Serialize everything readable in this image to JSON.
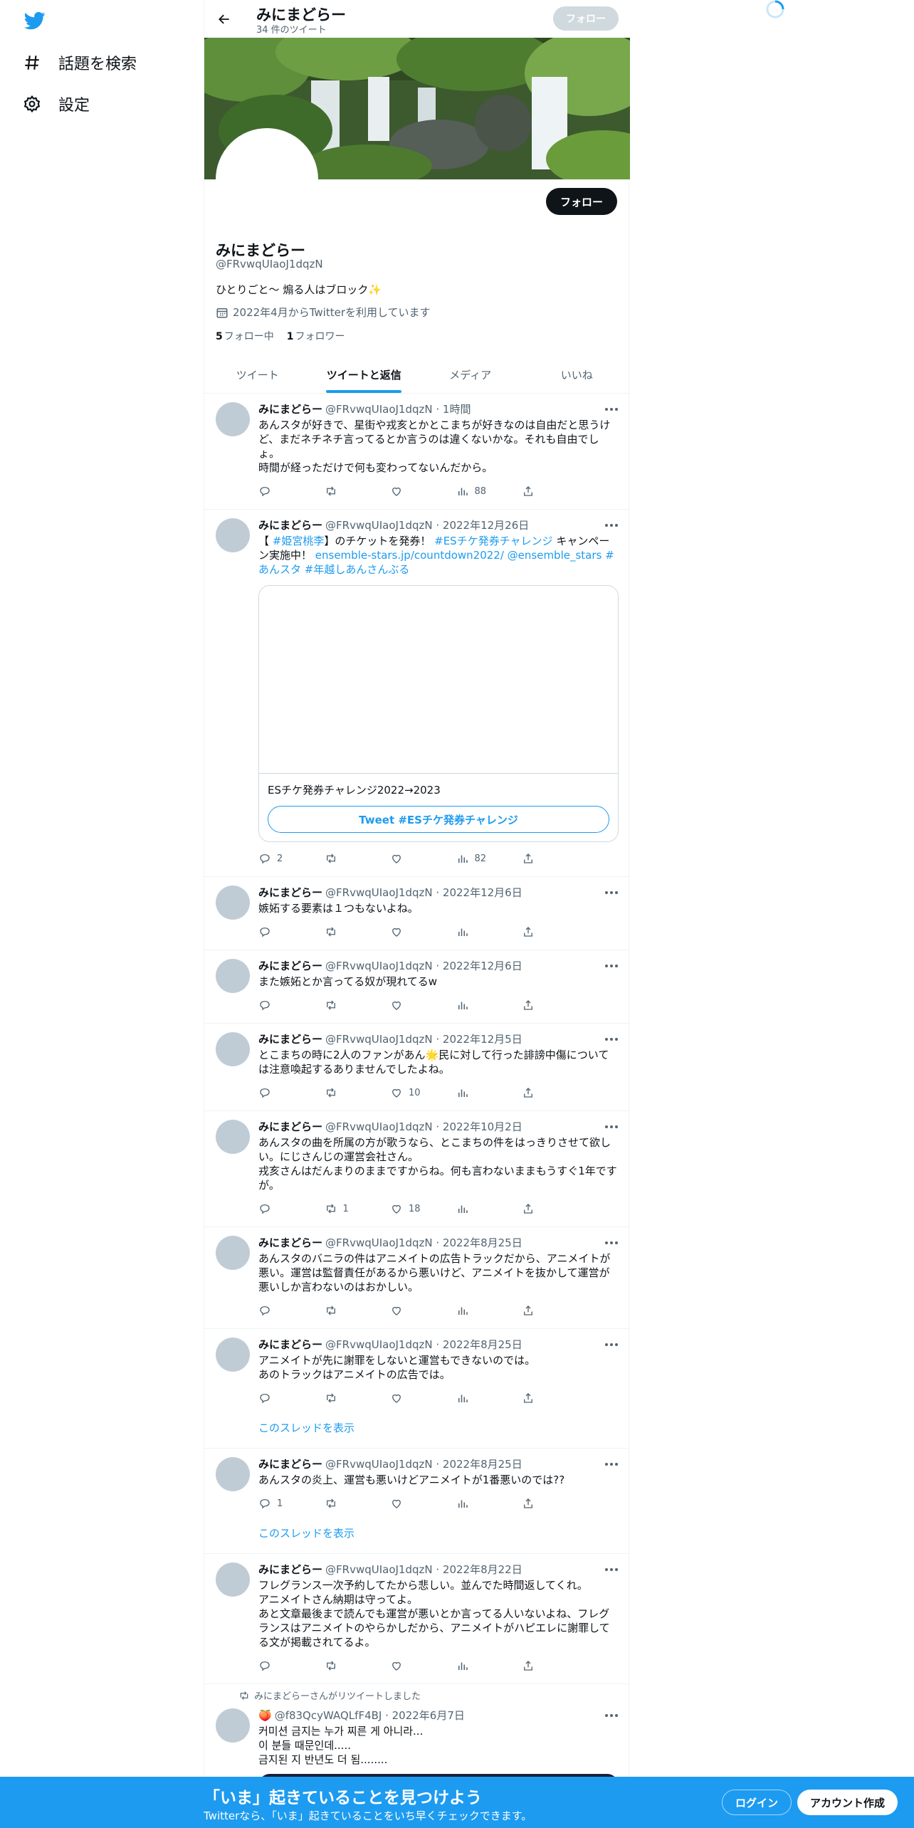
{
  "nav": {
    "explore": "話題を検索",
    "settings": "設定"
  },
  "header": {
    "name": "みにまどらー",
    "tweet_count": "34 件のツイート",
    "follow": "フォロー"
  },
  "profile": {
    "name": "みにまどらー",
    "handle": "@FRvwqUIaoJ1dqzN",
    "bio": "ひとりごと〜 煽る人はブロック✨",
    "joined": "2022年4月からTwitterを利用しています",
    "following_count": "5",
    "following_label": "フォロー中",
    "followers_count": "1",
    "followers_label": "フォロワー",
    "follow": "フォロー"
  },
  "tabs": [
    "ツイート",
    "ツイートと返信",
    "メディア",
    "いいね"
  ],
  "tweets": [
    {
      "name": "みにまどらー",
      "meta": "@FRvwqUIaoJ1dqzN · 1時間",
      "text": "あんスタが好きで、星街や戎亥とかとこまちが好きなのは自由だと思うけど、まだネチネチ言ってるとか言うのは違くないかな。それも自由でしょ。\n時間が経っただけで何も変わってないんだから。",
      "reply": "",
      "retweet": "",
      "like": "",
      "views": "88"
    },
    {
      "name": "みにまどらー",
      "meta": "@FRvwqUIaoJ1dqzN · 2022年12月26日",
      "text_a": "【 ",
      "tag1": "#姫宮桃李",
      "text_b": "】のチケットを発券！ ",
      "tag2": "#ESチケ発券チャレンジ",
      "text_c": " キャンペーン実施中！ ",
      "link": "ensemble-stars.jp/countdown2022/ @ensemble_stars #あんスタ #年越しあんさんぶる",
      "card_title": "ESチケ発券チャレンジ2022→2023",
      "card_button": "Tweet #ESチケ発券チャレンジ",
      "reply": "2",
      "retweet": "",
      "like": "",
      "views": "82"
    },
    {
      "name": "みにまどらー",
      "meta": "@FRvwqUIaoJ1dqzN · 2022年12月6日",
      "text": "嫉妬する要素は１つもないよね。",
      "reply": "",
      "retweet": "",
      "like": "",
      "views": ""
    },
    {
      "name": "みにまどらー",
      "meta": "@FRvwqUIaoJ1dqzN · 2022年12月6日",
      "text": "また嫉妬とか言ってる奴が現れてるw",
      "reply": "",
      "retweet": "",
      "like": "",
      "views": ""
    },
    {
      "name": "みにまどらー",
      "meta": "@FRvwqUIaoJ1dqzN · 2022年12月5日",
      "text": "とこまちの時に2人のファンがあん🌟民に対して行った誹謗中傷については注意喚起するありませんでしたよね。",
      "reply": "",
      "retweet": "",
      "like": "10",
      "views": ""
    },
    {
      "name": "みにまどらー",
      "meta": "@FRvwqUIaoJ1dqzN · 2022年10月2日",
      "text": "あんスタの曲を所属の方が歌うなら、とこまちの件をはっきりさせて欲しい。にじさんじの運営会社さん。\n戎亥さんはだんまりのままですからね。何も言わないままもうすぐ1年ですが。",
      "reply": "",
      "retweet": "1",
      "like": "18",
      "views": ""
    },
    {
      "name": "みにまどらー",
      "meta": "@FRvwqUIaoJ1dqzN · 2022年8月25日",
      "text": "あんスタのバニラの件はアニメイトの広告トラックだから、アニメイトが悪い。運営は監督責任があるから悪いけど、アニメイトを抜かして運営が悪いしか言わないのはおかしい。",
      "reply": "",
      "retweet": "",
      "like": "",
      "views": ""
    },
    {
      "name": "みにまどらー",
      "meta": "@FRvwqUIaoJ1dqzN · 2022年8月25日",
      "text": "アニメイトが先に謝罪をしないと運営もできないのでは。\nあのトラックはアニメイトの広告では。",
      "reply": "",
      "retweet": "",
      "like": "",
      "views": "",
      "thread": "このスレッドを表示"
    },
    {
      "name": "みにまどらー",
      "meta": "@FRvwqUIaoJ1dqzN · 2022年8月25日",
      "text": "あんスタの炎上、運営も悪いけどアニメイトが1番悪いのでは??",
      "reply": "1",
      "retweet": "",
      "like": "",
      "views": "",
      "thread": "このスレッドを表示"
    },
    {
      "name": "みにまどらー",
      "meta": "@FRvwqUIaoJ1dqzN · 2022年8月22日",
      "text": "フレグランス一次予約してたから悲しい。並んでた時間返してくれ。\nアニメイトさん納期は守ってよ。\nあと文章最後まで読んでも運営が悪いとか言ってる人いないよね、フレグランスはアニメイトのやらかしだから、アニメイトがハピエレに謝罪してる文が掲載されてるよ。",
      "reply": "",
      "retweet": "",
      "like": "",
      "views": ""
    },
    {
      "rt_note": "みにまどらーさんがリツイートしました",
      "name": "🍑",
      "meta": "@f83QcyWAQLfF4BJ · 2022年6月7日",
      "text": "커미션 금지는 누가 찌른 게 아니라...\n이 분들 때문인데.....\n금지된 지 반년도 더 됨........"
    }
  ],
  "bottom": {
    "title": "「いま」起きていることを見つけよう",
    "subtitle": "Twitterなら、「いま」起きていることをいち早くチェックできます。",
    "login": "ログイン",
    "signup": "アカウント作成"
  },
  "colors": {
    "accent": "#1d9bf0",
    "text": "#0f1419",
    "muted": "#536471"
  }
}
